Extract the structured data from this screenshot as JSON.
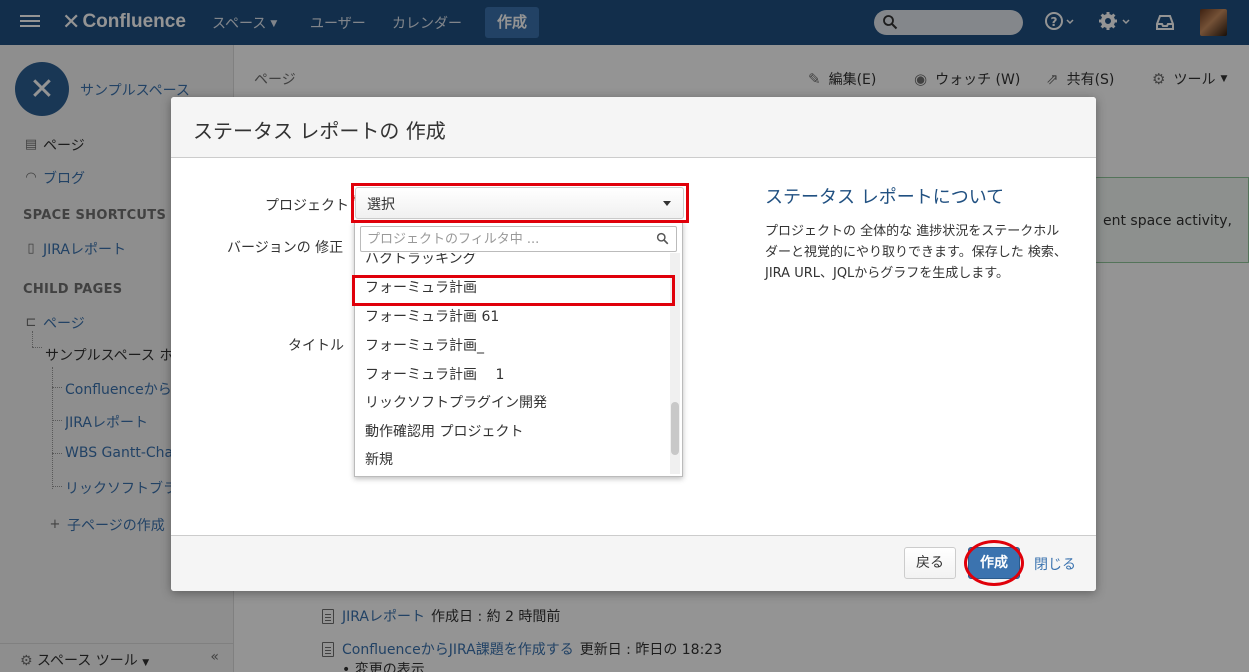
{
  "header": {
    "logo_text": "Confluence",
    "nav": [
      "スペース",
      "ユーザー",
      "カレンダー"
    ],
    "create_label": "作成",
    "help_icon": "help-icon",
    "settings_icon": "gear-icon",
    "notifications_icon": "inbox-icon"
  },
  "sidebar": {
    "space_name": "サンプルスペース",
    "pages_label": "ページ",
    "blog_label": "ブログ",
    "shortcuts_heading": "SPACE SHORTCUTS",
    "shortcut_jira": "JIRAレポート",
    "child_pages_heading": "CHILD PAGES",
    "tree_root": "ページ",
    "tree_home": "サンプルスペース ホ",
    "tree_children": [
      "Confluenceから」",
      "JIRAレポート",
      "WBS Gantt-Cha",
      "リックソフトブラグ"
    ],
    "add_child": "子ページの作成",
    "space_tools": "スペース ツール",
    "collapse_icon": "double-chevron-left-icon"
  },
  "main": {
    "breadcrumb": "ページ",
    "actions": {
      "edit": "編集(E)",
      "watch": "ウォッチ (W)",
      "share": "共有(S)",
      "tools": "ツール"
    },
    "info_text": "ent space activity,",
    "recent": [
      {
        "link": "JIRAレポート",
        "meta": "作成日 : 約 2 時間前"
      },
      {
        "link": "ConfluenceからJIRA課題を作成する",
        "meta": "更新日 : 昨日の 18:23"
      }
    ],
    "recent_sub": "• 変更の表示"
  },
  "dialog": {
    "title": "ステータス レポートの 作成",
    "project_label": "プロジェクト",
    "required_mark": "*",
    "version_label": "バージョンの 修正",
    "title_label": "タイトル",
    "select_value": "選択",
    "filter_placeholder": "プロジェクトのフィルタ中 ...",
    "options": [
      "ハクトラッキング",
      "フォーミュラ計画",
      "フォーミュラ計画 61",
      "フォーミュラ計画_",
      "フォーミュラ計画　 1",
      "リックソフトプラグイン開発",
      "動作確認用 プロジェクト",
      "新規"
    ],
    "about_title": "ステータス レポートについて",
    "about_text": "プロジェクトの 全体的な 進捗状況をステークホルダーと視覚的にやり取りできます。保存した 検索、JIRA URL、JQLからグラフを生成します。",
    "back_label": "戻る",
    "create_label": "作成",
    "close_label": "閉じる"
  },
  "colors": {
    "header_bg": "#205081",
    "primary": "#3b73af",
    "highlight": "#e0000a"
  }
}
